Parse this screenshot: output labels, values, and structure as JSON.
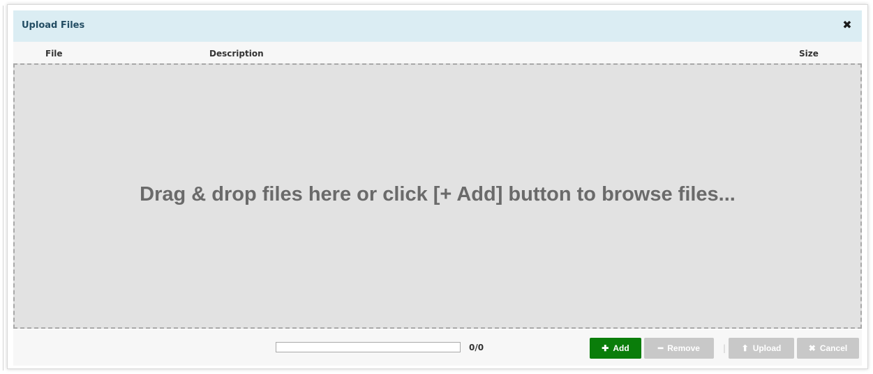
{
  "dialog": {
    "title": "Upload Files",
    "close_icon": "close-icon",
    "close_glyph": "✖"
  },
  "table": {
    "columns": [
      "File",
      "Description",
      "Size"
    ]
  },
  "dropzone": {
    "message": "Drag & drop files here or click [+ Add] button to browse files..."
  },
  "footer": {
    "progress": 0,
    "count": "0/0",
    "separator": "|",
    "buttons": {
      "add": {
        "label": "Add",
        "glyph": "✚",
        "icon": "plus-icon",
        "enabled": true,
        "color": "#0a7d0a"
      },
      "remove": {
        "label": "Remove",
        "glyph": "━",
        "icon": "minus-icon",
        "enabled": false,
        "color": "#c8c8c8"
      },
      "upload": {
        "label": "Upload",
        "glyph": "⬆",
        "icon": "upload-icon",
        "enabled": false,
        "color": "#c8c8c8"
      },
      "cancel": {
        "label": "Cancel",
        "glyph": "✖",
        "icon": "cancel-icon",
        "enabled": false,
        "color": "#c8c8c8"
      }
    }
  }
}
